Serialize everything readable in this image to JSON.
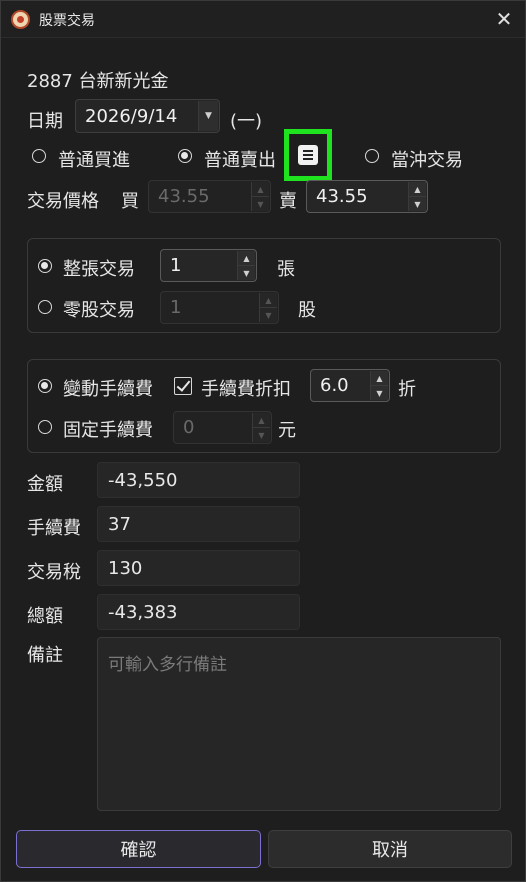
{
  "window": {
    "title": "股票交易"
  },
  "stock": {
    "code_name": "2887 台新新光金"
  },
  "date": {
    "label": "日期",
    "value": "2026/9/14",
    "weekday": "(一)"
  },
  "trade_type": {
    "options": [
      "普通買進",
      "普通賣出",
      "當沖交易"
    ],
    "selected": "普通賣出"
  },
  "price": {
    "label": "交易價格",
    "buy_label": "買",
    "buy_value": "43.55",
    "sell_label": "賣",
    "sell_value": "43.55"
  },
  "quantity": {
    "whole_label": "整張交易",
    "whole_value": "1",
    "whole_unit": "張",
    "odd_label": "零股交易",
    "odd_value": "1",
    "odd_unit": "股",
    "selected": "整張交易"
  },
  "fee": {
    "variable_label": "變動手續費",
    "discount_label": "手續費折扣",
    "discount_checked": true,
    "discount_value": "6.0",
    "discount_unit": "折",
    "fixed_label": "固定手續費",
    "fixed_value": "0",
    "fixed_unit": "元",
    "selected": "變動手續費"
  },
  "summary": {
    "amount_label": "金額",
    "amount_value": "-43,550",
    "fee_label": "手續費",
    "fee_value": "37",
    "tax_label": "交易稅",
    "tax_value": "130",
    "total_label": "總額",
    "total_value": "-43,383"
  },
  "memo": {
    "label": "備註",
    "placeholder": "可輸入多行備註"
  },
  "buttons": {
    "confirm": "確認",
    "cancel": "取消"
  },
  "colors": {
    "highlight": "#1ee31e",
    "accent": "#7b6fd0",
    "background": "#1e1e1e"
  }
}
